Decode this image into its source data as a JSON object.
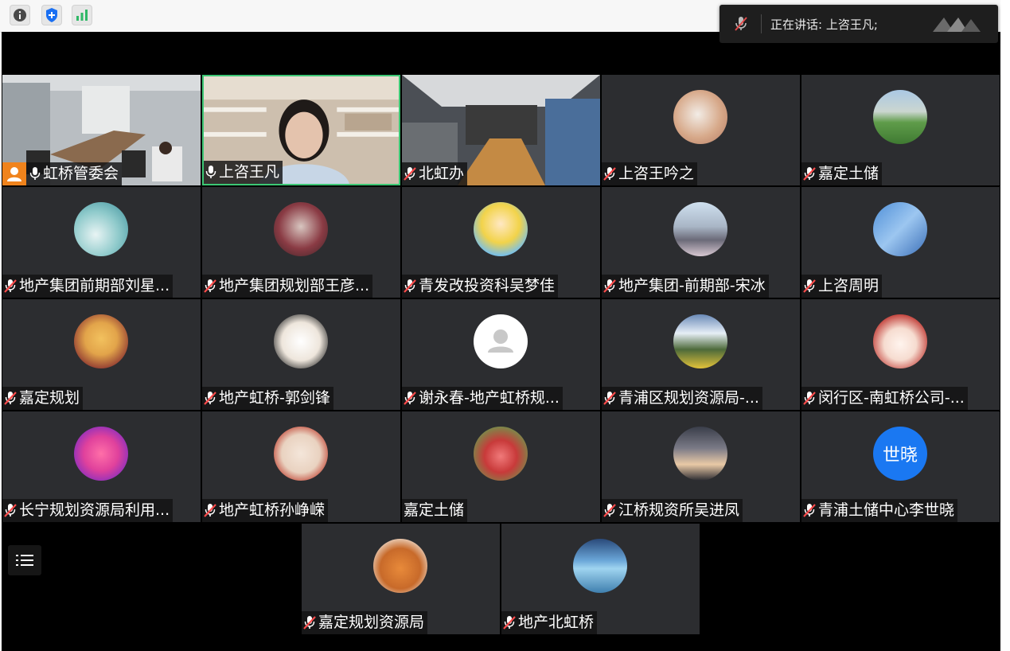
{
  "toolbar": {
    "icons": [
      "info-icon",
      "shield-plus-icon",
      "signal-bars-icon"
    ]
  },
  "speaking_banner": {
    "text": "正在讲话: 上咨王凡;"
  },
  "colors": {
    "tile_bg": "#2c2d30",
    "stage_bg": "#000000",
    "active_border": "#3cc774",
    "mic_muted": "#ff4b4b",
    "host_badge": "#f0831c",
    "text_avatar": "#1a78f2"
  },
  "participants": [
    {
      "name": "虹桥管委会",
      "mic": "on",
      "host": true,
      "video": true
    },
    {
      "name": "上咨王凡",
      "mic": "on",
      "video": true,
      "active": true
    },
    {
      "name": "北虹办",
      "mic": "muted",
      "video": true
    },
    {
      "name": "上咨王吟之",
      "mic": "muted"
    },
    {
      "name": "嘉定土储",
      "mic": "muted"
    },
    {
      "name": "地产集团前期部刘星...",
      "mic": "muted"
    },
    {
      "name": "地产集团规划部王彦...",
      "mic": "muted"
    },
    {
      "name": "青发改投资科吴梦佳",
      "mic": "muted"
    },
    {
      "name": "地产集团-前期部-宋冰",
      "mic": "muted"
    },
    {
      "name": "上咨周明",
      "mic": "muted"
    },
    {
      "name": "嘉定规划",
      "mic": "muted"
    },
    {
      "name": "地产虹桥-郭剑锋",
      "mic": "muted"
    },
    {
      "name": "谢永春-地产虹桥规...",
      "mic": "muted"
    },
    {
      "name": "青浦区规划资源局-...",
      "mic": "muted"
    },
    {
      "name": "闵行区-南虹桥公司-...",
      "mic": "muted"
    },
    {
      "name": "长宁规划资源局利用...",
      "mic": "muted"
    },
    {
      "name": "地产虹桥孙峥嵘",
      "mic": "muted"
    },
    {
      "name": "嘉定土储",
      "mic": "none"
    },
    {
      "name": "江桥规资所吴进凤",
      "mic": "muted"
    },
    {
      "name": "青浦土储中心李世晓",
      "mic": "muted",
      "avatar_text": "世晓"
    },
    {
      "name": "嘉定规划资源局",
      "mic": "muted"
    },
    {
      "name": "地产北虹桥",
      "mic": "muted"
    }
  ]
}
